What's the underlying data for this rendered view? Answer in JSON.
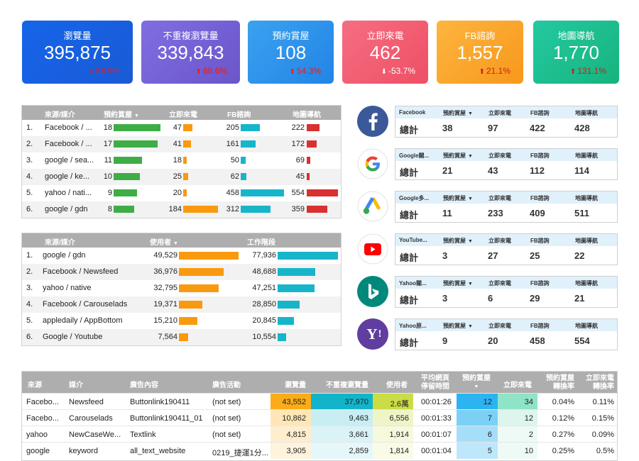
{
  "kpis": [
    {
      "label": "瀏覽量",
      "value": "395,875",
      "change": "68.9%",
      "dir": "up",
      "change_color": "#e02020",
      "bg_from": "#1565e9",
      "bg_to": "#1a5ad6"
    },
    {
      "label": "不重複瀏覽量",
      "value": "339,843",
      "change": "68.6%",
      "dir": "up",
      "change_color": "#e02020",
      "bg_from": "#7f6ee2",
      "bg_to": "#6b55c9"
    },
    {
      "label": "預約賞屋",
      "value": "108",
      "change": "54.3%",
      "dir": "up",
      "change_color": "#e02020",
      "bg_from": "#3aa2ef",
      "bg_to": "#2384e6"
    },
    {
      "label": "立即來電",
      "value": "462",
      "change": "-53.7%",
      "dir": "down",
      "change_color": "#ffffff",
      "bg_from": "#f56e82",
      "bg_to": "#ef4f64"
    },
    {
      "label": "FB諮詢",
      "value": "1,557",
      "change": "21.1%",
      "dir": "up",
      "change_color": "#d11a1a",
      "bg_from": "#fdb53f",
      "bg_to": "#f7981c"
    },
    {
      "label": "地圖導航",
      "value": "1,770",
      "change": "131.1%",
      "dir": "up",
      "change_color": "#d11a1a",
      "bg_from": "#24c9a0",
      "bg_to": "#17b37e"
    }
  ],
  "source_table": {
    "headers": {
      "source": "來源/媒介",
      "booking": "預約賞屋",
      "call": "立即來電",
      "fb": "FB諮詢",
      "map": "地圖導航"
    },
    "rows": [
      {
        "idx": "1.",
        "source": "Facebook / ...",
        "booking": 18,
        "call": 47,
        "fb": 205,
        "map": 222
      },
      {
        "idx": "2.",
        "source": "Facebook / ...",
        "booking": 17,
        "call": 41,
        "fb": 161,
        "map": 172
      },
      {
        "idx": "3.",
        "source": "google / sea...",
        "booking": 11,
        "call": 18,
        "fb": 50,
        "map": 69
      },
      {
        "idx": "4.",
        "source": "google / ke...",
        "booking": 10,
        "call": 25,
        "fb": 62,
        "map": 45
      },
      {
        "idx": "5.",
        "source": "yahoo / nati...",
        "booking": 9,
        "call": 20,
        "fb": 458,
        "map": 554
      },
      {
        "idx": "6.",
        "source": "google / gdn",
        "booking": 8,
        "call": 184,
        "fb": 312,
        "map": 359
      }
    ]
  },
  "user_table": {
    "headers": {
      "source": "來源/媒介",
      "users": "使用者",
      "sessions": "工作階段"
    },
    "rows": [
      {
        "idx": "1.",
        "source": "google / gdn",
        "users": "49,529",
        "users_v": 49529,
        "sessions": "77,936",
        "sessions_v": 77936
      },
      {
        "idx": "2.",
        "source": "Facebook / Newsfeed",
        "users": "36,976",
        "users_v": 36976,
        "sessions": "48,688",
        "sessions_v": 48688
      },
      {
        "idx": "3.",
        "source": "yahoo / native",
        "users": "32,795",
        "users_v": 32795,
        "sessions": "47,251",
        "sessions_v": 47251
      },
      {
        "idx": "4.",
        "source": "Facebook / Carouselads",
        "users": "19,371",
        "users_v": 19371,
        "sessions": "28,850",
        "sessions_v": 28850
      },
      {
        "idx": "5.",
        "source": "appledaily / AppBottom",
        "users": "15,210",
        "users_v": 15210,
        "sessions": "20,845",
        "sessions_v": 20845
      },
      {
        "idx": "6.",
        "source": "Google / Youtube",
        "users": "7,564",
        "users_v": 7564,
        "sessions": "10,554",
        "sessions_v": 10554
      }
    ]
  },
  "channels": {
    "col_booking": "預約賞屋",
    "col_call": "立即來電",
    "col_fb": "FB諮詢",
    "col_map": "地圖導航",
    "total_label": "總計",
    "items": [
      {
        "icon": "facebook-icon",
        "name": "Facebook",
        "booking": "38",
        "call": "97",
        "fb": "422",
        "map": "428"
      },
      {
        "icon": "google-icon",
        "name": "Google關...",
        "booking": "21",
        "call": "43",
        "fb": "112",
        "map": "114"
      },
      {
        "icon": "google-ads-icon",
        "name": "Google多...",
        "booking": "11",
        "call": "233",
        "fb": "409",
        "map": "511"
      },
      {
        "icon": "youtube-icon",
        "name": "YouTube...",
        "booking": "3",
        "call": "27",
        "fb": "25",
        "map": "22"
      },
      {
        "icon": "bing-icon",
        "name": "Yahoo關...",
        "booking": "3",
        "call": "6",
        "fb": "29",
        "map": "21"
      },
      {
        "icon": "yahoo-icon",
        "name": "Yahoo原...",
        "booking": "9",
        "call": "20",
        "fb": "458",
        "map": "554"
      }
    ]
  },
  "detail_table": {
    "headers": {
      "source": "來源",
      "medium": "媒介",
      "ad_content": "廣告內容",
      "campaign": "廣告活動",
      "pageviews": "瀏覽量",
      "unique_pv": "不重複瀏覽量",
      "users": "使用者",
      "avg_time_1": "平均網頁",
      "avg_time_2": "停留時間",
      "booking": "預約賞屋",
      "call": "立即來電",
      "booking_rate_1": "預約賞屋",
      "booking_rate_2": "轉換率",
      "call_rate_1": "立即來電",
      "call_rate_2": "轉換率"
    },
    "rows": [
      {
        "source": "Facebo...",
        "medium": "Newsfeed",
        "ad": "Buttonlink190411",
        "campaign": "(not set)",
        "pv": "43,552",
        "upv": "37,970",
        "users": "2.6萬",
        "time": "00:01:26",
        "booking": "12",
        "call": "34",
        "brate": "0.04%",
        "crate": "0.11%"
      },
      {
        "source": "Facebo...",
        "medium": "Carouselads",
        "ad": "Buttonlink190411_01",
        "campaign": "(not set)",
        "pv": "10,862",
        "upv": "9,463",
        "users": "6,556",
        "time": "00:01:33",
        "booking": "7",
        "call": "12",
        "brate": "0.12%",
        "crate": "0.15%"
      },
      {
        "source": "yahoo",
        "medium": "NewCaseWe...",
        "ad": "Textlink",
        "campaign": "(not set)",
        "pv": "4,815",
        "upv": "3,661",
        "users": "1,914",
        "time": "00:01:07",
        "booking": "6",
        "call": "2",
        "brate": "0.27%",
        "crate": "0.09%"
      },
      {
        "source": "google",
        "medium": "keyword",
        "ad": "all_text_website",
        "campaign": "0219_捷運1分...",
        "pv": "3,905",
        "upv": "2,859",
        "users": "1,814",
        "time": "00:01:04",
        "booking": "5",
        "call": "10",
        "brate": "0.25%",
        "crate": "0.5%"
      }
    ]
  }
}
